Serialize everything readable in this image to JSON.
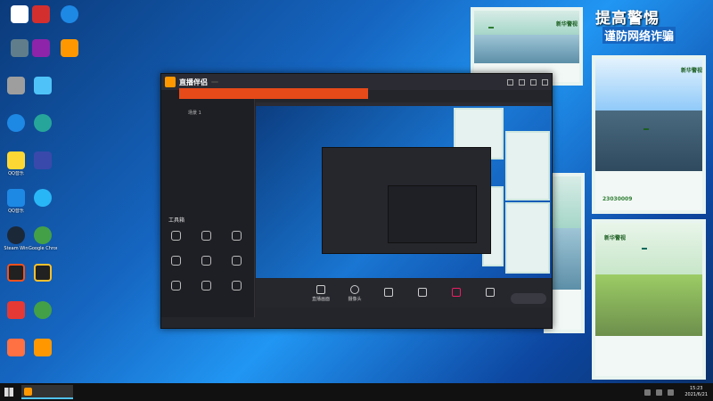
{
  "desktop_icons": [
    {
      "label": "",
      "color": "#ffffff"
    },
    {
      "label": "",
      "color": "#d32f2f"
    },
    {
      "label": "",
      "color": "#1e88e5"
    },
    {
      "label": "",
      "color": "#607d8b"
    },
    {
      "label": "",
      "color": "#8e24aa"
    },
    {
      "label": "",
      "color": "#ff9800"
    },
    {
      "label": "",
      "color": "#9e9e9e"
    },
    {
      "label": "",
      "color": "#4fc3f7"
    },
    {
      "label": "",
      "color": "#1e88e5"
    },
    {
      "label": "",
      "color": "#26a69a"
    },
    {
      "label": "QQ音乐",
      "color": "#fdd835"
    },
    {
      "label": "",
      "color": "#3949ab"
    },
    {
      "label": "QQ音乐",
      "color": "#1e88e5"
    },
    {
      "label": "",
      "color": "#29b6f6"
    },
    {
      "label": "Steam Win",
      "color": "#1b2838"
    },
    {
      "label": "Google Chrome",
      "color": "#43a047"
    },
    {
      "label": "",
      "color": "#f4511e"
    },
    {
      "label": "",
      "color": "#fbc02d"
    },
    {
      "label": "",
      "color": "#e53935"
    },
    {
      "label": "",
      "color": "#43a047"
    },
    {
      "label": "",
      "color": "#ff7043"
    }
  ],
  "app": {
    "title": "直播伴侣",
    "version": "",
    "notice": "",
    "scene_label": "场景 1",
    "tools_title": "工具箱",
    "tools": [
      "",
      "",
      "",
      "",
      "",
      "",
      "",
      "",
      ""
    ],
    "footer_text": "",
    "preview_tabs": [
      "",
      "",
      "",
      "",
      ""
    ],
    "bottom_bar": [
      "直播画面",
      "摄像头",
      "",
      "",
      "",
      ""
    ],
    "start_live": ""
  },
  "posters": {
    "title_main": "提高警惕",
    "title_sub": "谨防网络诈骗",
    "p1_title": "新华警视",
    "p1_banner": "",
    "p2_title": "新华警视",
    "p2_banner": "",
    "p2_num": "23030009",
    "p3_title": "",
    "p3_num": "",
    "p4_title": "新华警视",
    "p4_banner": ""
  },
  "taskbar": {
    "app_label": "",
    "lang": "",
    "time": "15:23",
    "date": "2021/6/21"
  },
  "colors": {
    "accent": "#1565c0",
    "orange": "#ff9800",
    "notice": "#e64a19"
  }
}
